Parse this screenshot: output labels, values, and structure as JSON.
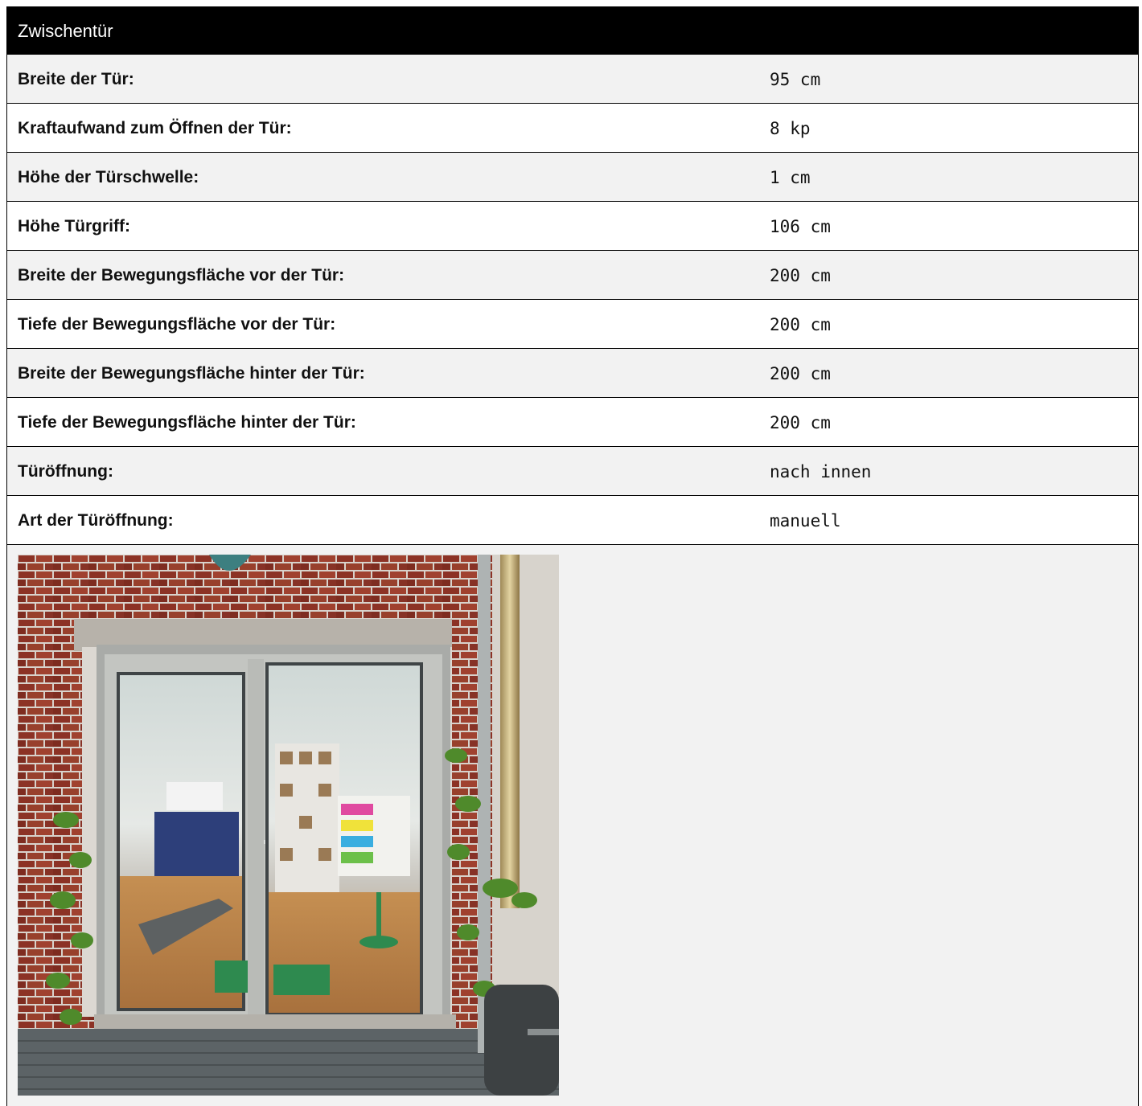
{
  "section": {
    "title": "Zwischentür"
  },
  "rows": [
    {
      "label": "Breite der Tür:",
      "value": "95 cm"
    },
    {
      "label": "Kraftaufwand zum Öffnen der Tür:",
      "value": "8 kp"
    },
    {
      "label": "Höhe der Türschwelle:",
      "value": "1 cm"
    },
    {
      "label": "Höhe Türgriff:",
      "value": "106 cm"
    },
    {
      "label": "Breite der Bewegungsfläche vor der Tür:",
      "value": "200 cm"
    },
    {
      "label": "Tiefe der Bewegungsfläche vor der Tür:",
      "value": "200 cm"
    },
    {
      "label": "Breite der Bewegungsfläche hinter der Tür:",
      "value": "200 cm"
    },
    {
      "label": "Tiefe der Bewegungsfläche hinter der Tür:",
      "value": "200 cm"
    },
    {
      "label": "Türöffnung:",
      "value": "nach innen"
    },
    {
      "label": "Art der Türöffnung:",
      "value": "manuell"
    }
  ],
  "colors": {
    "header_bg": "#000000",
    "header_text": "#ffffff",
    "row_alt": "#f2f2f2",
    "row_base": "#ffffff"
  }
}
